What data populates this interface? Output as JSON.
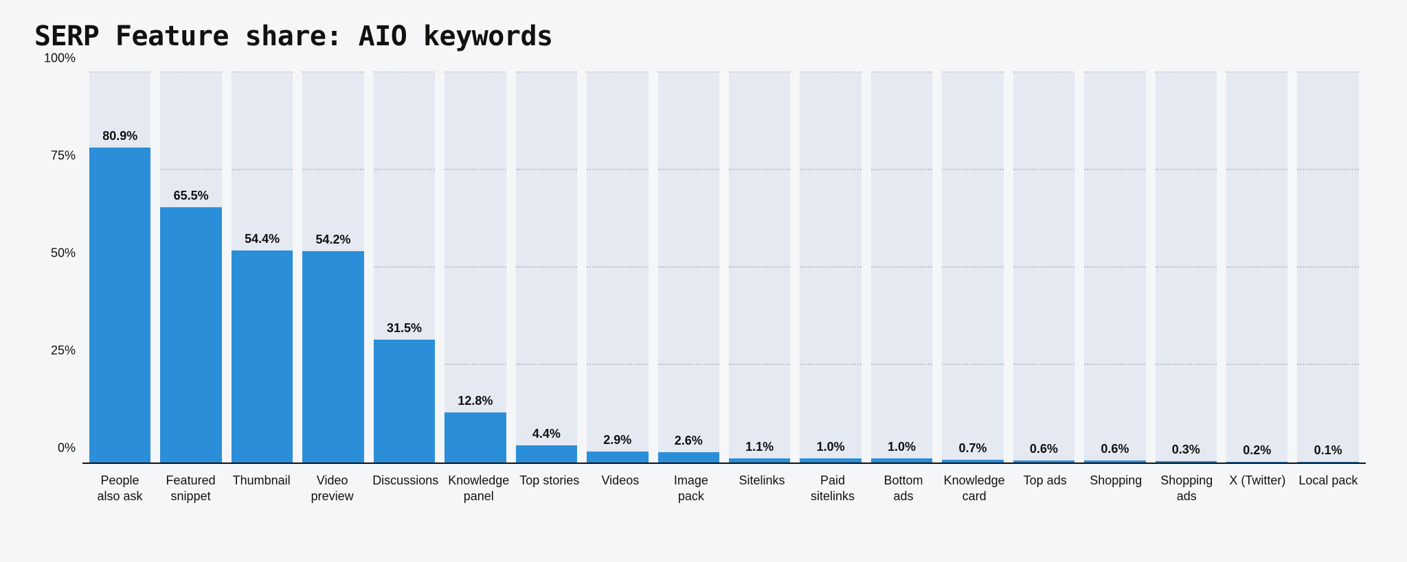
{
  "title": "SERP Feature share: AIO keywords",
  "chart_data": {
    "type": "bar",
    "title": "SERP Feature share: AIO keywords",
    "xlabel": "",
    "ylabel": "",
    "ylim": [
      0,
      100
    ],
    "yticks": [
      0,
      25,
      50,
      75,
      100
    ],
    "ytick_labels": [
      "0%",
      "25%",
      "50%",
      "75%",
      "100%"
    ],
    "categories": [
      "People also ask",
      "Featured snippet",
      "Thumbnail",
      "Video preview",
      "Discussions",
      "Knowledge panel",
      "Top stories",
      "Videos",
      "Image pack",
      "Sitelinks",
      "Paid sitelinks",
      "Bottom ads",
      "Knowledge card",
      "Top ads",
      "Shopping",
      "Shopping ads",
      "X (Twitter)",
      "Local pack"
    ],
    "values": [
      80.9,
      65.5,
      54.4,
      54.2,
      31.5,
      12.8,
      4.4,
      2.9,
      2.6,
      1.1,
      1.0,
      1.0,
      0.7,
      0.6,
      0.6,
      0.3,
      0.2,
      0.1
    ],
    "value_labels": [
      "80.9%",
      "65.5%",
      "54.4%",
      "54.2%",
      "31.5%",
      "12.8%",
      "4.4%",
      "2.9%",
      "2.6%",
      "1.1%",
      "1.0%",
      "1.0%",
      "0.7%",
      "0.6%",
      "0.6%",
      "0.3%",
      "0.2%",
      "0.1%"
    ]
  }
}
